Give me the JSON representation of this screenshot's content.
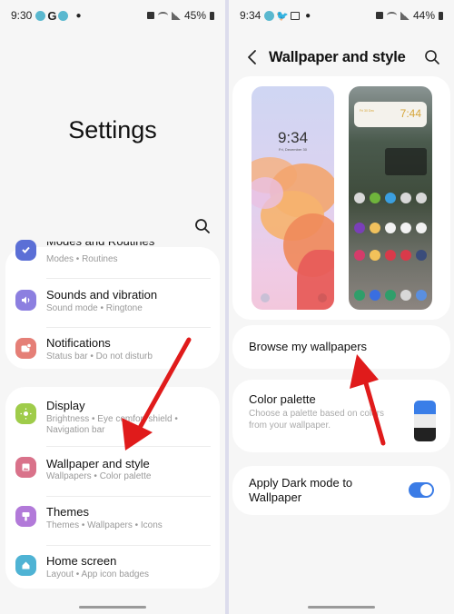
{
  "left": {
    "status": {
      "time": "9:30",
      "battery": "45%"
    },
    "title": "Settings",
    "items_group1": [
      {
        "title": "Modes and Routines",
        "sub": "Modes  •  Routines",
        "icon": "modes-routines-icon",
        "color": "#5b6fd6"
      },
      {
        "title": "Sounds and vibration",
        "sub": "Sound mode  •  Ringtone",
        "icon": "speaker-icon",
        "color": "#8c7fe0"
      },
      {
        "title": "Notifications",
        "sub": "Status bar  •  Do not disturb",
        "icon": "notification-icon",
        "color": "#e57f77"
      }
    ],
    "items_group2": [
      {
        "title": "Display",
        "sub": "Brightness  •  Eye comfort shield  •",
        "sub2": "Navigation bar",
        "icon": "display-icon",
        "color": "#9fcc4a"
      },
      {
        "title": "Wallpaper and style",
        "sub": "Wallpapers  •  Color palette",
        "icon": "wallpaper-icon",
        "color": "#d9728a"
      },
      {
        "title": "Themes",
        "sub": "Themes  •  Wallpapers  •  Icons",
        "icon": "themes-icon",
        "color": "#b27ad9"
      },
      {
        "title": "Home screen",
        "sub": "Layout  •  App icon badges",
        "icon": "home-icon",
        "color": "#4fb3d4"
      }
    ]
  },
  "right": {
    "status": {
      "time": "9:34",
      "battery": "44%"
    },
    "header": {
      "title": "Wallpaper and style"
    },
    "lock_preview": {
      "time": "9:34",
      "date": "Fri, December 30"
    },
    "home_preview": {
      "time": "7:44"
    },
    "browse": {
      "label": "Browse my wallpapers"
    },
    "palette": {
      "title": "Color palette",
      "sub": "Choose a palette based on colors from your wallpaper.",
      "colors": [
        "#3a7ee8",
        "#ececec",
        "#222222"
      ]
    },
    "dark_mode": {
      "label_line1": "Apply Dark mode to",
      "label_line2": "Wallpaper",
      "enabled": true
    }
  },
  "annotation": {
    "arrow_color": "#e01b1b"
  }
}
